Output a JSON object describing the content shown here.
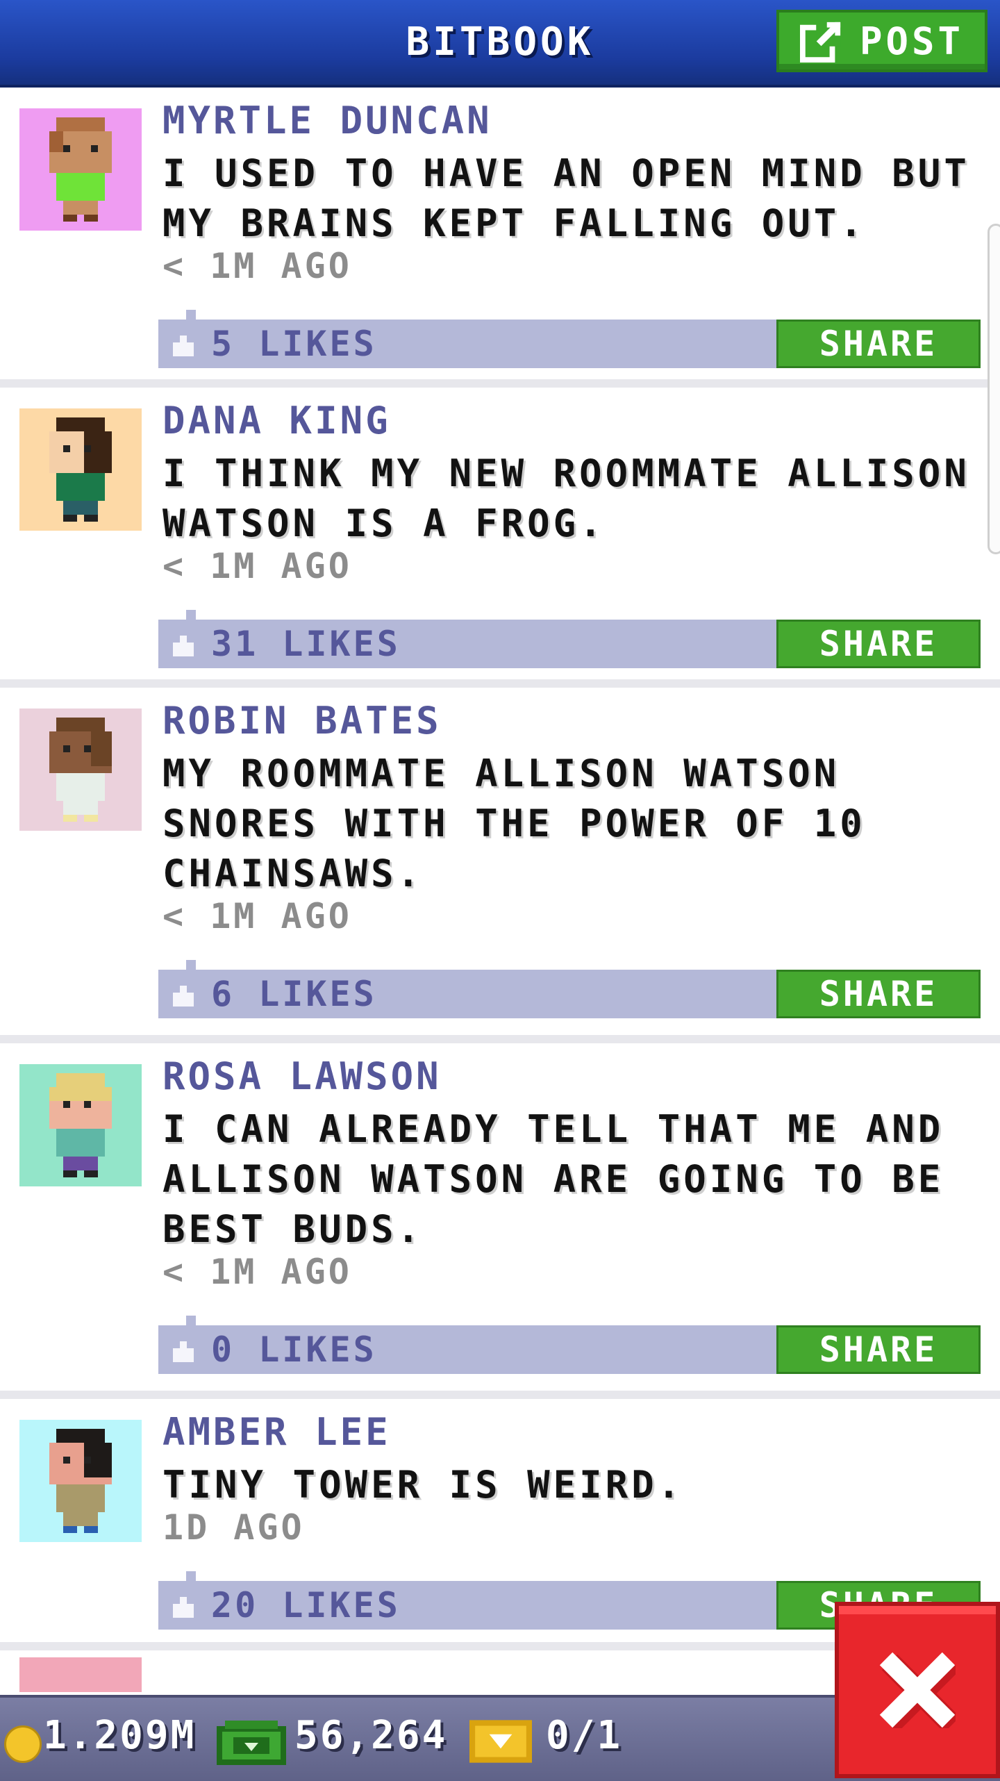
{
  "header": {
    "title": "BITBOOK",
    "post_label": "POST"
  },
  "posts": [
    {
      "name": "MYRTLE DUNCAN",
      "text": "I USED TO HAVE AN OPEN MIND BUT MY BRAINS KEPT FALLING OUT.",
      "time": "< 1M AGO",
      "likes": "5 LIKES",
      "share": "SHARE",
      "avatar_bg": "#ef9cf2"
    },
    {
      "name": "DANA KING",
      "text": "I THINK MY NEW ROOMMATE ALLISON WATSON IS A FROG.",
      "time": "< 1M AGO",
      "likes": "31 LIKES",
      "share": "SHARE",
      "avatar_bg": "#fdd9a6"
    },
    {
      "name": "ROBIN BATES",
      "text": "MY ROOMMATE ALLISON WATSON SNORES WITH THE POWER OF 10 CHAINSAWS.",
      "time": "< 1M AGO",
      "likes": "6 LIKES",
      "share": "SHARE",
      "avatar_bg": "#ebd1dc"
    },
    {
      "name": "ROSA LAWSON",
      "text": "I CAN ALREADY TELL THAT ME AND ALLISON WATSON ARE GOING TO BE BEST BUDS.",
      "time": "< 1M AGO",
      "likes": "0 LIKES",
      "share": "SHARE",
      "avatar_bg": "#93e5c9"
    },
    {
      "name": "AMBER LEE",
      "text": "TINY TOWER IS WEIRD.",
      "time": "1D AGO",
      "likes": "20 LIKES",
      "share": "SHARE",
      "avatar_bg": "#b9f6fb"
    }
  ],
  "status": {
    "coins": "1.209M",
    "bux": "56,264",
    "tickets": "0/1"
  },
  "colors": {
    "header_blue": "#1b3b9e",
    "share_green": "#45a82f",
    "like_bar": "#b4b8d8",
    "name_purple": "#55579a",
    "close_red": "#e8262c"
  }
}
